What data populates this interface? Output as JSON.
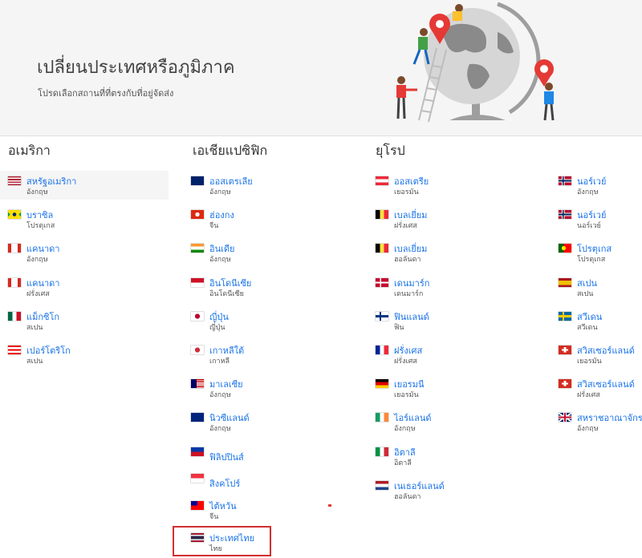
{
  "header": {
    "title": "เปลี่ยนประเทศหรือภูมิภาค",
    "subtitle": "โปรดเลือกสถานที่ที่ตรงกับที่อยู่จัดส่ง"
  },
  "regions": {
    "americas": "อเมริกา",
    "apac": "เอเชียแปซิฟิก",
    "europe": "ยุโรป"
  },
  "americas": [
    {
      "name": "สหรัฐอเมริกา",
      "lang": "อังกฤษ",
      "flag": "us"
    },
    {
      "name": "บราซิล",
      "lang": "โปรตุเกส",
      "flag": "br"
    },
    {
      "name": "แคนาดา",
      "lang": "อังกฤษ",
      "flag": "ca"
    },
    {
      "name": "แคนาดา",
      "lang": "ฝรั่งเศส",
      "flag": "ca"
    },
    {
      "name": "แม็กซิโก",
      "lang": "สเปน",
      "flag": "mx"
    },
    {
      "name": "เปอร์โตริโก",
      "lang": "สเปน",
      "flag": "pr"
    }
  ],
  "apac": [
    {
      "name": "ออสเตรเลีย",
      "lang": "อังกฤษ",
      "flag": "au"
    },
    {
      "name": "ฮ่องกง",
      "lang": "จีน",
      "flag": "hk"
    },
    {
      "name": "อินเดีย",
      "lang": "อังกฤษ",
      "flag": "in"
    },
    {
      "name": "อินโดนีเซีย",
      "lang": "อินโดนีเซีย",
      "flag": "id"
    },
    {
      "name": "ญี่ปุ่น",
      "lang": "ญี่ปุ่น",
      "flag": "jp"
    },
    {
      "name": "เกาหลีใต้",
      "lang": "เกาหลี",
      "flag": "kr"
    },
    {
      "name": "มาเลเซีย",
      "lang": "อังกฤษ",
      "flag": "my"
    },
    {
      "name": "นิวซีแลนด์",
      "lang": "อังกฤษ",
      "flag": "nz"
    },
    {
      "name": "ฟิลิปปินส์",
      "lang": "",
      "flag": "ph"
    },
    {
      "name": "สิงคโปร์",
      "lang": "",
      "flag": "sg"
    },
    {
      "name": "ไต้หวัน",
      "lang": "จีน",
      "flag": "tw"
    },
    {
      "name": "ประเทศไทย",
      "lang": "ไทย",
      "flag": "th"
    }
  ],
  "europe_col1": [
    {
      "name": "ออสเตรีย",
      "lang": "เยอรมัน",
      "flag": "at"
    },
    {
      "name": "เบลเยี่ยม",
      "lang": "ฝรั่งเศส",
      "flag": "be"
    },
    {
      "name": "เบลเยี่ยม",
      "lang": "ฮอลันดา",
      "flag": "be"
    },
    {
      "name": "เดนมาร์ก",
      "lang": "เดนมาร์ก",
      "flag": "dk"
    },
    {
      "name": "ฟินแลนด์",
      "lang": "ฟิน",
      "flag": "fi"
    },
    {
      "name": "ฝรั่งเศส",
      "lang": "ฝรั่งเศส",
      "flag": "fr"
    },
    {
      "name": "เยอรมนี",
      "lang": "เยอรมัน",
      "flag": "de"
    },
    {
      "name": "ไอร์แลนด์",
      "lang": "อังกฤษ",
      "flag": "ie"
    },
    {
      "name": "อิตาลี",
      "lang": "อิตาลี",
      "flag": "it"
    },
    {
      "name": "เนเธอร์แลนด์",
      "lang": "ฮอลันดา",
      "flag": "nl"
    }
  ],
  "europe_col2": [
    {
      "name": "นอร์เวย์",
      "lang": "อังกฤษ",
      "flag": "no"
    },
    {
      "name": "นอร์เวย์",
      "lang": "นอร์เวย์",
      "flag": "no"
    },
    {
      "name": "โปรตุเกส",
      "lang": "โปรตุเกส",
      "flag": "pt"
    },
    {
      "name": "สเปน",
      "lang": "สเปน",
      "flag": "es"
    },
    {
      "name": "สวีเดน",
      "lang": "สวีเดน",
      "flag": "se"
    },
    {
      "name": "สวิสเซอร์แลนด์",
      "lang": "เยอรมัน",
      "flag": "ch"
    },
    {
      "name": "สวิสเซอร์แลนด์",
      "lang": "ฝรั่งเศส",
      "flag": "ch"
    },
    {
      "name": "สหราชอาณาจักร",
      "lang": "อังกฤษ",
      "flag": "gb"
    }
  ]
}
